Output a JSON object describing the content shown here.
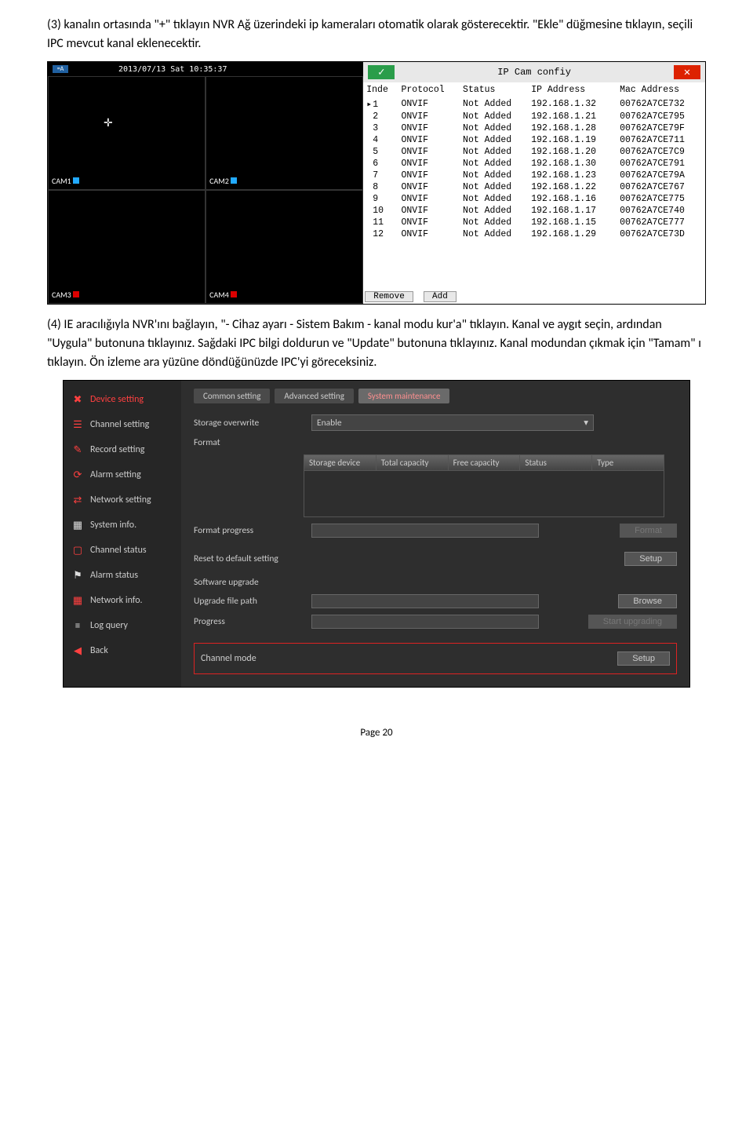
{
  "intro_text": "(3) kanalın ortasında \"+\" tıklayın NVR Ağ üzerindeki ip kameraları otomatik olarak gösterecektir. \"Ekle\" düğmesine tıklayın, seçili IPC mevcut kanal eklenecektir.",
  "mid_text": "(4) IE aracılığıyla NVR'ını bağlayın, \"- Cihaz ayarı - Sistem Bakım - kanal modu kur'a\" tıklayın. Kanal ve aygıt seçin, ardından \"Uygula\" butonuna tıklayınız. Sağdaki IPC bilgi doldurun ve \"Update\" butonuna tıklayınız. Kanal modundan çıkmak için \"Tamam\" ı tıklayın. Ön izleme ara yüzüne döndüğünüzde IPC'yi göreceksiniz.",
  "nvr": {
    "datetime": "2013/07/13 Sat 10:35:37",
    "status_label": "=A",
    "cams": [
      "CAM1",
      "CAM2",
      "CAM3",
      "CAM4"
    ]
  },
  "ipcam": {
    "title": "IP Cam confiy",
    "ok_glyph": "✓",
    "close_glyph": "✕",
    "headers": {
      "index": "Inde",
      "protocol": "Protocol",
      "status": "Status",
      "ip": "IP Address",
      "mac": "Mac Address"
    },
    "rows": [
      {
        "index": "1",
        "protocol": "ONVIF",
        "status": "Not Added",
        "ip": "192.168.1.32",
        "mac": "00762A7CE732"
      },
      {
        "index": "2",
        "protocol": "ONVIF",
        "status": "Not Added",
        "ip": "192.168.1.21",
        "mac": "00762A7CE795"
      },
      {
        "index": "3",
        "protocol": "ONVIF",
        "status": "Not Added",
        "ip": "192.168.1.28",
        "mac": "00762A7CE79F"
      },
      {
        "index": "4",
        "protocol": "ONVIF",
        "status": "Not Added",
        "ip": "192.168.1.19",
        "mac": "00762A7CE711"
      },
      {
        "index": "5",
        "protocol": "ONVIF",
        "status": "Not Added",
        "ip": "192.168.1.20",
        "mac": "00762A7CE7C9"
      },
      {
        "index": "6",
        "protocol": "ONVIF",
        "status": "Not Added",
        "ip": "192.168.1.30",
        "mac": "00762A7CE791"
      },
      {
        "index": "7",
        "protocol": "ONVIF",
        "status": "Not Added",
        "ip": "192.168.1.23",
        "mac": "00762A7CE79A"
      },
      {
        "index": "8",
        "protocol": "ONVIF",
        "status": "Not Added",
        "ip": "192.168.1.22",
        "mac": "00762A7CE767"
      },
      {
        "index": "9",
        "protocol": "ONVIF",
        "status": "Not Added",
        "ip": "192.168.1.16",
        "mac": "00762A7CE775"
      },
      {
        "index": "10",
        "protocol": "ONVIF",
        "status": "Not Added",
        "ip": "192.168.1.17",
        "mac": "00762A7CE740"
      },
      {
        "index": "11",
        "protocol": "ONVIF",
        "status": "Not Added",
        "ip": "192.168.1.15",
        "mac": "00762A7CE777"
      },
      {
        "index": "12",
        "protocol": "ONVIF",
        "status": "Not Added",
        "ip": "192.168.1.29",
        "mac": "00762A7CE73D"
      }
    ],
    "remove_label": "Remove",
    "add_label": "Add"
  },
  "settings": {
    "sidebar": [
      {
        "label": "Device setting",
        "icon": "✖"
      },
      {
        "label": "Channel setting",
        "icon": "☰"
      },
      {
        "label": "Record setting",
        "icon": "✎"
      },
      {
        "label": "Alarm setting",
        "icon": "⟳"
      },
      {
        "label": "Network setting",
        "icon": "⇄"
      },
      {
        "label": "System info.",
        "icon": "▦"
      },
      {
        "label": "Channel status",
        "icon": "▢"
      },
      {
        "label": "Alarm status",
        "icon": "⚑"
      },
      {
        "label": "Network info.",
        "icon": "▦"
      },
      {
        "label": "Log query",
        "icon": "≡"
      },
      {
        "label": "Back",
        "icon": "◀"
      }
    ],
    "tabs": {
      "common": "Common setting",
      "advanced": "Advanced setting",
      "maintenance": "System maintenance"
    },
    "labels": {
      "storage_overwrite": "Storage overwrite",
      "format": "Format",
      "format_progress": "Format progress",
      "reset": "Reset to default setting",
      "software_upgrade": "Software upgrade",
      "upgrade_path": "Upgrade file path",
      "progress": "Progress",
      "channel_mode": "Channel mode"
    },
    "values": {
      "storage_overwrite": "Enable"
    },
    "table_headers": {
      "device": "Storage device",
      "total": "Total capacity",
      "free": "Free capacity",
      "status": "Status",
      "type": "Type"
    },
    "buttons": {
      "format": "Format",
      "setup": "Setup",
      "browse": "Browse",
      "start_upgrading": "Start upgrading"
    }
  },
  "page_number": "Page 20"
}
